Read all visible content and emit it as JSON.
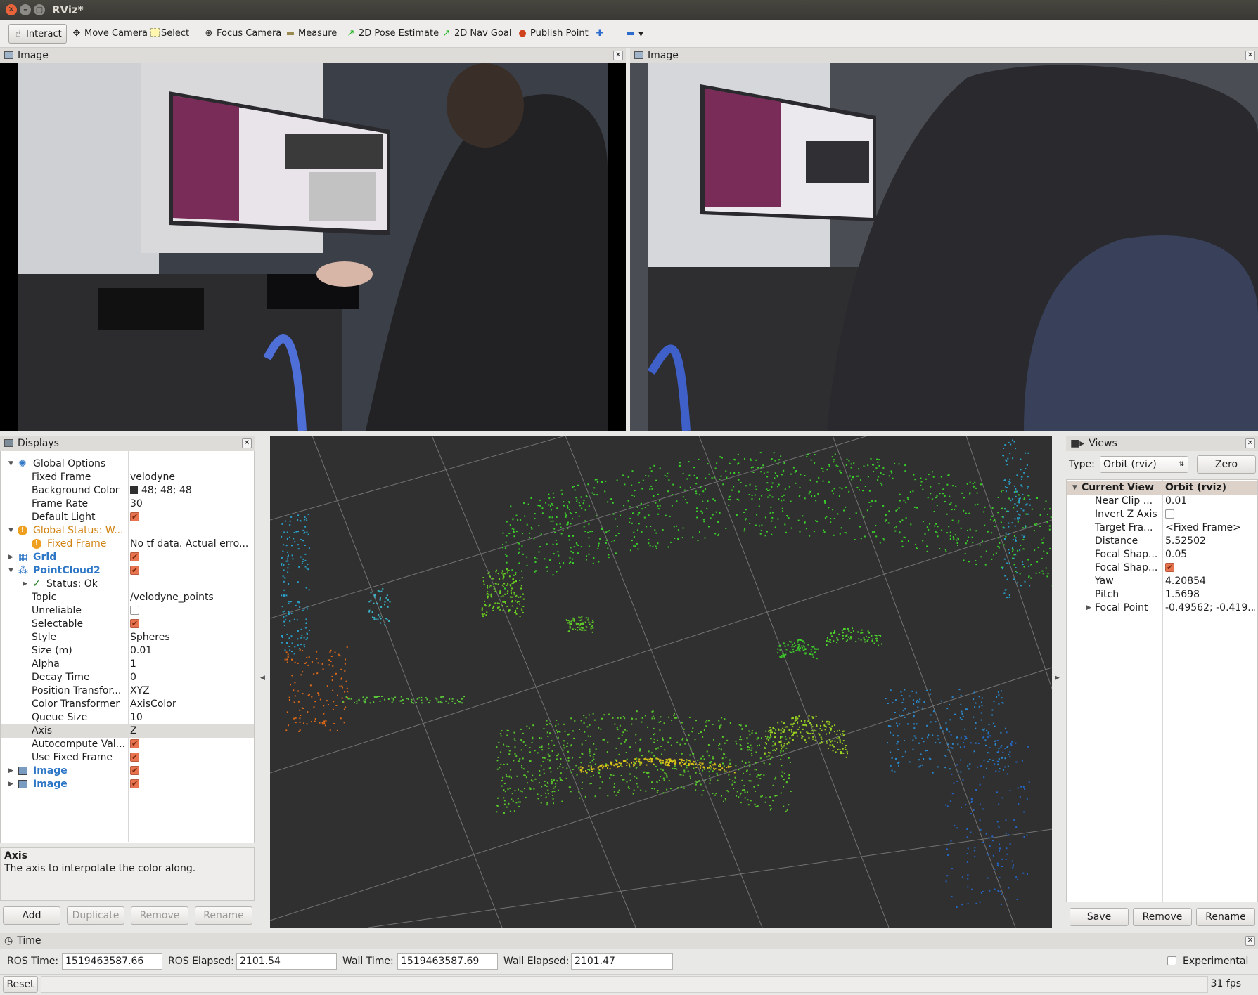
{
  "window": {
    "title": "RViz*"
  },
  "toolbar": {
    "tools": [
      {
        "label": "Interact",
        "icon": "hand-icon"
      },
      {
        "label": "Move Camera",
        "icon": "move-camera-icon"
      },
      {
        "label": "Select",
        "icon": "select-icon"
      },
      {
        "label": "Focus Camera",
        "icon": "focus-camera-icon"
      },
      {
        "label": "Measure",
        "icon": "ruler-icon"
      },
      {
        "label": "2D Pose Estimate",
        "icon": "green-arrow-icon"
      },
      {
        "label": "2D Nav Goal",
        "icon": "green-arrow-icon"
      },
      {
        "label": "Publish Point",
        "icon": "map-pin-icon"
      }
    ],
    "add_icon": "plus-icon",
    "remove_icon": "minus-icon"
  },
  "image_panels": [
    {
      "title": "Image"
    },
    {
      "title": "Image"
    }
  ],
  "displays": {
    "title": "Displays",
    "rows": [
      {
        "key": "Global Options",
        "value": ""
      },
      {
        "key": "Fixed Frame",
        "value": "velodyne"
      },
      {
        "key": "Background Color",
        "value": "48; 48; 48"
      },
      {
        "key": "Frame Rate",
        "value": "30"
      },
      {
        "key": "Default Light",
        "value": ""
      },
      {
        "key": "Global Status: W...",
        "value": ""
      },
      {
        "key": "Fixed Frame",
        "value": "No tf data.  Actual erro..."
      },
      {
        "key": "Grid",
        "value": ""
      },
      {
        "key": "PointCloud2",
        "value": ""
      },
      {
        "key": "Status: Ok",
        "value": ""
      },
      {
        "key": "Topic",
        "value": "/velodyne_points"
      },
      {
        "key": "Unreliable",
        "value": ""
      },
      {
        "key": "Selectable",
        "value": ""
      },
      {
        "key": "Style",
        "value": "Spheres"
      },
      {
        "key": "Size (m)",
        "value": "0.01"
      },
      {
        "key": "Alpha",
        "value": "1"
      },
      {
        "key": "Decay Time",
        "value": "0"
      },
      {
        "key": "Position Transfor...",
        "value": "XYZ"
      },
      {
        "key": "Color Transformer",
        "value": "AxisColor"
      },
      {
        "key": "Queue Size",
        "value": "10"
      },
      {
        "key": "Axis",
        "value": "Z"
      },
      {
        "key": "Autocompute Val...",
        "value": ""
      },
      {
        "key": "Use Fixed Frame",
        "value": ""
      },
      {
        "key": "Image",
        "value": ""
      },
      {
        "key": "Image",
        "value": ""
      }
    ],
    "desc_title": "Axis",
    "desc_text": "The axis to interpolate the color along.",
    "buttons": {
      "add": "Add",
      "duplicate": "Duplicate",
      "remove": "Remove",
      "rename": "Rename"
    },
    "bg_color": "#303030"
  },
  "views": {
    "title": "Views",
    "type_label": "Type:",
    "type_value": "Orbit (rviz)",
    "zero": "Zero",
    "rows": [
      {
        "key": "Current View",
        "value": "Orbit (rviz)"
      },
      {
        "key": "Near Clip ...",
        "value": "0.01"
      },
      {
        "key": "Invert Z Axis",
        "value": ""
      },
      {
        "key": "Target Fra...",
        "value": "<Fixed Frame>"
      },
      {
        "key": "Distance",
        "value": "5.52502"
      },
      {
        "key": "Focal Shap...",
        "value": "0.05"
      },
      {
        "key": "Focal Shap...",
        "value": ""
      },
      {
        "key": "Yaw",
        "value": "4.20854"
      },
      {
        "key": "Pitch",
        "value": "1.5698"
      },
      {
        "key": "Focal Point",
        "value": "-0.49562; -0.419..."
      }
    ],
    "buttons": {
      "save": "Save",
      "remove": "Remove",
      "rename": "Rename"
    }
  },
  "time": {
    "title": "Time",
    "ros_time_label": "ROS Time:",
    "ros_time": "1519463587.66",
    "ros_elapsed_label": "ROS Elapsed:",
    "ros_elapsed": "2101.54",
    "wall_time_label": "Wall Time:",
    "wall_time": "1519463587.69",
    "wall_elapsed_label": "Wall Elapsed:",
    "wall_elapsed": "2101.47",
    "experimental": "Experimental"
  },
  "statusbar": {
    "reset": "Reset",
    "fps": "31 fps"
  }
}
